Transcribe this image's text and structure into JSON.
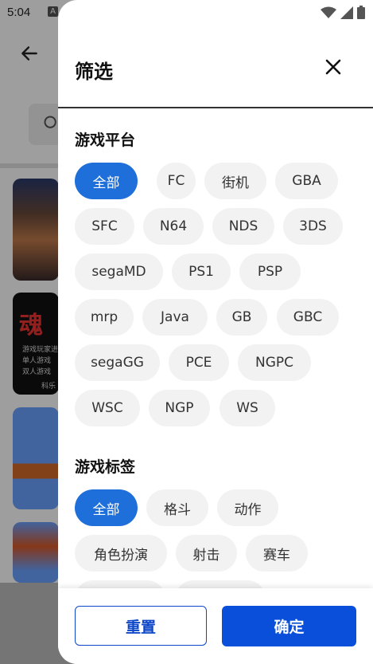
{
  "status_bar": {
    "time": "5:04",
    "notification_letter": "A"
  },
  "background": {
    "thumb2_kanji": "魂",
    "thumb2_lines": [
      "游戏玩家进",
      "单人游戏",
      "双人游戏",
      "科乐"
    ]
  },
  "panel": {
    "title": "筛选",
    "platform_section": {
      "title": "游戏平台",
      "chips": [
        {
          "label": "全部",
          "selected": true
        },
        {
          "label": "FC",
          "selected": false
        },
        {
          "label": "街机",
          "selected": false
        },
        {
          "label": "GBA",
          "selected": false
        },
        {
          "label": "SFC",
          "selected": false
        },
        {
          "label": "N64",
          "selected": false
        },
        {
          "label": "NDS",
          "selected": false
        },
        {
          "label": "3DS",
          "selected": false
        },
        {
          "label": "segaMD",
          "selected": false
        },
        {
          "label": "PS1",
          "selected": false
        },
        {
          "label": "PSP",
          "selected": false
        },
        {
          "label": "mrp",
          "selected": false
        },
        {
          "label": "Java",
          "selected": false
        },
        {
          "label": "GB",
          "selected": false
        },
        {
          "label": "GBC",
          "selected": false
        },
        {
          "label": "segaGG",
          "selected": false
        },
        {
          "label": "PCE",
          "selected": false
        },
        {
          "label": "NGPC",
          "selected": false
        },
        {
          "label": "WSC",
          "selected": false
        },
        {
          "label": "NGP",
          "selected": false
        },
        {
          "label": "WS",
          "selected": false
        }
      ]
    },
    "tag_section": {
      "title": "游戏标签",
      "chips": [
        {
          "label": "全部",
          "selected": true
        },
        {
          "label": "格斗",
          "selected": false
        },
        {
          "label": "动作",
          "selected": false
        },
        {
          "label": "角色扮演",
          "selected": false
        },
        {
          "label": "射击",
          "selected": false
        },
        {
          "label": "赛车",
          "selected": false
        }
      ]
    },
    "footer": {
      "reset_label": "重置",
      "confirm_label": "确定"
    }
  },
  "colors": {
    "accent": "#1e6fd9",
    "confirm": "#0a4fd9",
    "chip_bg": "#f2f2f2"
  }
}
